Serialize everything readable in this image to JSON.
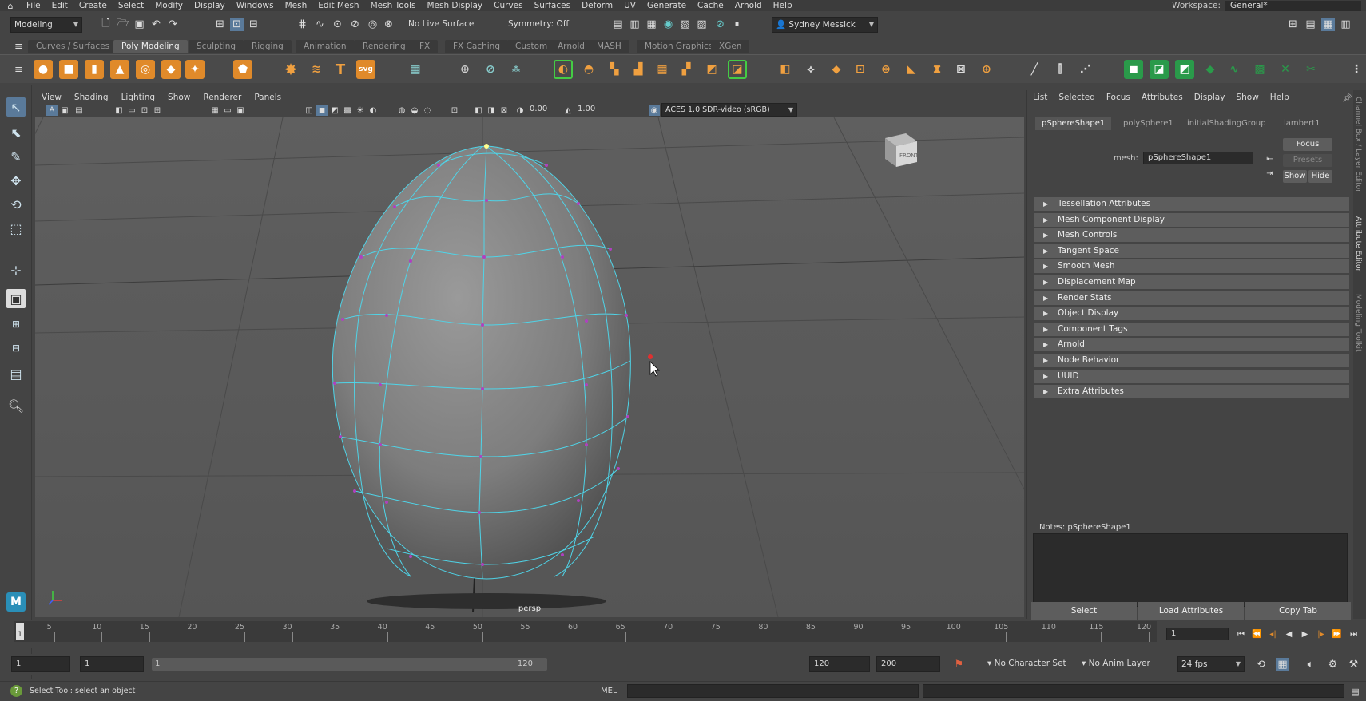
{
  "menubar": {
    "items": [
      "File",
      "Edit",
      "Create",
      "Select",
      "Modify",
      "Display",
      "Windows",
      "Mesh",
      "Edit Mesh",
      "Mesh Tools",
      "Mesh Display",
      "Curves",
      "Surfaces",
      "Deform",
      "UV",
      "Generate",
      "Cache",
      "Arnold",
      "Help"
    ],
    "workspace_label": "Workspace:",
    "workspace_value": "General*"
  },
  "statusline": {
    "mode": "Modeling",
    "live_surface": "No Live Surface",
    "symmetry": "Symmetry: Off",
    "user": "Sydney Messick"
  },
  "shelf_tabs": [
    "Curves / Surfaces",
    "Poly Modeling",
    "Sculpting",
    "Rigging",
    "Animation",
    "Rendering",
    "FX",
    "FX Caching",
    "Custom",
    "Arnold",
    "MASH",
    "Motion Graphics",
    "XGen"
  ],
  "shelf_active_tab": "Poly Modeling",
  "viewport": {
    "menu": [
      "View",
      "Shading",
      "Lighting",
      "Show",
      "Renderer",
      "Panels"
    ],
    "exposure": "0.00",
    "gamma": "1.00",
    "color_space": "ACES 1.0 SDR-video (sRGB)",
    "camera_label": "persp",
    "viewcube_label": "FRONT"
  },
  "attribute_editor": {
    "menu": [
      "List",
      "Selected",
      "Focus",
      "Attributes",
      "Display",
      "Show",
      "Help"
    ],
    "tabs": [
      "pSphereShape1",
      "polySphere1",
      "initialShadingGroup",
      "lambert1"
    ],
    "mesh_label": "mesh:",
    "mesh_value": "pSphereShape1",
    "focus_btn": "Focus",
    "presets_btn": "Presets",
    "show_btn": "Show",
    "hide_btn": "Hide",
    "sections": [
      "Tessellation Attributes",
      "Mesh Component Display",
      "Mesh Controls",
      "Tangent Space",
      "Smooth Mesh",
      "Displacement Map",
      "Render Stats",
      "Object Display",
      "Component Tags",
      "Arnold",
      "Node Behavior",
      "UUID",
      "Extra Attributes"
    ],
    "notes_label": "Notes:  pSphereShape1",
    "bottom_buttons": [
      "Select",
      "Load Attributes",
      "Copy Tab"
    ]
  },
  "side_tabs": [
    "Channel Box / Layer Editor",
    "Attribute Editor",
    "Modeling Toolkit"
  ],
  "timeslider": {
    "labels": [
      "5",
      "10",
      "15",
      "20",
      "25",
      "30",
      "35",
      "40",
      "45",
      "50",
      "55",
      "60",
      "65",
      "70",
      "75",
      "80",
      "85",
      "90",
      "95",
      "100",
      "105",
      "110",
      "115",
      "120"
    ],
    "current_frame_marker": "1",
    "current_frame": "1"
  },
  "range": {
    "start_time": "1",
    "start_range": "1",
    "slider_start": "1",
    "slider_end": "120",
    "end_range": "120",
    "end_time": "200",
    "character_set": "No Character Set",
    "anim_layer": "No Anim Layer",
    "fps": "24 fps"
  },
  "commandline": {
    "help_text": "Select Tool: select an object",
    "lang": "MEL"
  }
}
